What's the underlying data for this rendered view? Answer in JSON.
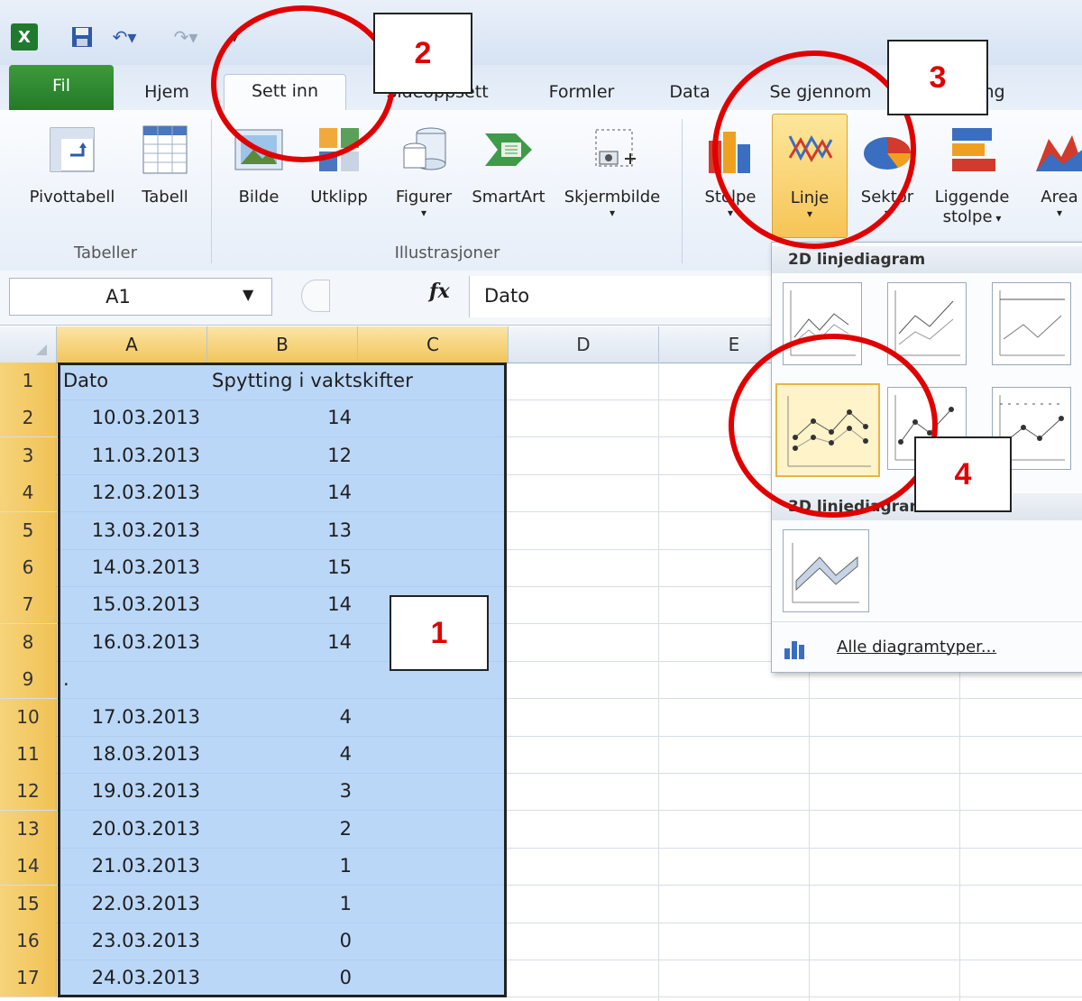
{
  "tabs": {
    "file": "Fil",
    "home": "Hjem",
    "insert": "Sett inn",
    "page_layout": "Sideoppsett",
    "formulas": "Formler",
    "data": "Data",
    "review": "Se gjennom",
    "view": "Visning"
  },
  "ribbon": {
    "pivot": "Pivottabell",
    "table": "Tabell",
    "picture": "Bilde",
    "clipart": "Utklipp",
    "shapes": "Figurer",
    "smartart": "SmartArt",
    "screenshot": "Skjermbilde",
    "column": "Stolpe",
    "line": "Linje",
    "pie": "Sektor",
    "bar_line1": "Liggende",
    "bar_line2": "stolpe",
    "area": "Area",
    "group_tables": "Tabeller",
    "group_illustrations": "Illustrasjoner"
  },
  "formula_bar": {
    "name_box": "A1",
    "fx": "fx",
    "content": "Dato"
  },
  "columns": [
    "A",
    "B",
    "C",
    "D",
    "E"
  ],
  "rows": [
    {
      "n": "1",
      "a": "Dato",
      "b": "Spytting i vaktskifter"
    },
    {
      "n": "2",
      "a": "10.03.2013",
      "b": "14"
    },
    {
      "n": "3",
      "a": "11.03.2013",
      "b": "12"
    },
    {
      "n": "4",
      "a": "12.03.2013",
      "b": "14"
    },
    {
      "n": "5",
      "a": "13.03.2013",
      "b": "13"
    },
    {
      "n": "6",
      "a": "14.03.2013",
      "b": "15"
    },
    {
      "n": "7",
      "a": "15.03.2013",
      "b": "14"
    },
    {
      "n": "8",
      "a": "16.03.2013",
      "b": "14"
    },
    {
      "n": "9",
      "a": ".",
      "b": ""
    },
    {
      "n": "10",
      "a": "17.03.2013",
      "b": "4"
    },
    {
      "n": "11",
      "a": "18.03.2013",
      "b": "4"
    },
    {
      "n": "12",
      "a": "19.03.2013",
      "b": "3"
    },
    {
      "n": "13",
      "a": "20.03.2013",
      "b": "2"
    },
    {
      "n": "14",
      "a": "21.03.2013",
      "b": "1"
    },
    {
      "n": "15",
      "a": "22.03.2013",
      "b": "1"
    },
    {
      "n": "16",
      "a": "23.03.2013",
      "b": "0"
    },
    {
      "n": "17",
      "a": "24.03.2013",
      "b": "0"
    }
  ],
  "dropdown": {
    "section_2d": "2D linjediagram",
    "section_3d": "3D linjediagram",
    "all_types": "Alle diagramtyper..."
  },
  "annotations": {
    "step1": "1",
    "step2": "2",
    "step3": "3",
    "step4": "4",
    "color": "#e00000"
  }
}
